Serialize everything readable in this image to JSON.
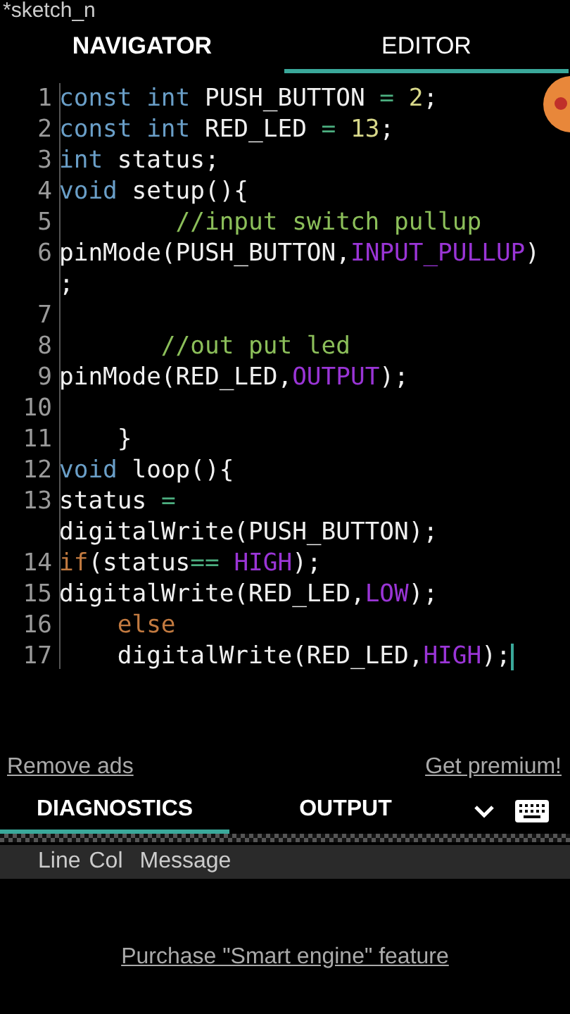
{
  "window": {
    "title": "*sketch_n"
  },
  "tabs": [
    {
      "label": "NAVIGATOR",
      "selected": false
    },
    {
      "label": "EDITOR",
      "selected": true
    }
  ],
  "editor": {
    "lines": [
      {
        "number": "1",
        "tokens": [
          {
            "kind": "keyword",
            "text": "const int "
          },
          {
            "kind": "plain",
            "text": "PUSH_BUTTON "
          },
          {
            "kind": "operator",
            "text": "= "
          },
          {
            "kind": "number",
            "text": "2"
          },
          {
            "kind": "plain",
            "text": ";"
          }
        ]
      },
      {
        "number": "2",
        "tokens": [
          {
            "kind": "keyword",
            "text": "const int "
          },
          {
            "kind": "plain",
            "text": "RED_LED "
          },
          {
            "kind": "operator",
            "text": "= "
          },
          {
            "kind": "number",
            "text": "13"
          },
          {
            "kind": "plain",
            "text": ";"
          }
        ]
      },
      {
        "number": "3",
        "tokens": [
          {
            "kind": "keyword",
            "text": "int "
          },
          {
            "kind": "plain",
            "text": "status;"
          }
        ]
      },
      {
        "number": "4",
        "tokens": [
          {
            "kind": "keyword",
            "text": "void "
          },
          {
            "kind": "plain",
            "text": "setup(){"
          }
        ]
      },
      {
        "number": "5",
        "tokens": [
          {
            "kind": "comment",
            "text": "        //input switch pullup"
          }
        ]
      },
      {
        "number": "6",
        "tokens": [
          {
            "kind": "plain",
            "text": "pinMode(PUSH_BUTTON,"
          },
          {
            "kind": "constant",
            "text": "INPUT_PULLUP"
          },
          {
            "kind": "plain",
            "text": ")"
          },
          {
            "kind": "plain",
            "text": ";"
          }
        ]
      },
      {
        "number": "7"
      },
      {
        "number": "8",
        "tokens": [
          {
            "kind": "comment",
            "text": "       //out put led"
          }
        ]
      },
      {
        "number": "9",
        "tokens": [
          {
            "kind": "plain",
            "text": "pinMode(RED_LED,"
          },
          {
            "kind": "constant",
            "text": "OUTPUT"
          },
          {
            "kind": "plain",
            "text": ");"
          }
        ]
      },
      {
        "number": "10"
      },
      {
        "number": "11",
        "tokens": [
          {
            "kind": "plain",
            "text": "    }"
          }
        ]
      },
      {
        "number": "12",
        "tokens": [
          {
            "kind": "keyword",
            "text": "void "
          },
          {
            "kind": "plain",
            "text": "loop(){"
          }
        ]
      },
      {
        "number": "13",
        "tokens": [
          {
            "kind": "plain",
            "text": "status "
          },
          {
            "kind": "operator",
            "text": "= "
          },
          {
            "kind": "plain",
            "text": "digitalWrite(PUSH_BUTTON);"
          }
        ]
      },
      {
        "number": "14",
        "tokens": [
          {
            "kind": "control",
            "text": "if"
          },
          {
            "kind": "plain",
            "text": "(status"
          },
          {
            "kind": "operator",
            "text": "== "
          },
          {
            "kind": "constant",
            "text": "HIGH"
          },
          {
            "kind": "plain",
            "text": ");"
          }
        ]
      },
      {
        "number": "15",
        "tokens": [
          {
            "kind": "plain",
            "text": "digitalWrite(RED_LED,"
          },
          {
            "kind": "constant",
            "text": "LOW"
          },
          {
            "kind": "plain",
            "text": ");"
          }
        ]
      },
      {
        "number": "16",
        "tokens": [
          {
            "kind": "control",
            "text": "    else"
          }
        ]
      },
      {
        "number": "17",
        "tokens": [
          {
            "kind": "plain",
            "text": "    digitalWrite(RED_LED,"
          },
          {
            "kind": "constant",
            "text": "HIGH"
          },
          {
            "kind": "plain",
            "text": ");"
          }
        ]
      }
    ]
  },
  "links": [
    "Remove ads",
    "Get premium!"
  ],
  "bottom_tabs": [
    {
      "label": "DIAGNOSTICS",
      "selected": true
    },
    {
      "label": "OUTPUT",
      "selected": false
    }
  ],
  "diagnostics": {
    "columns": [
      "Line",
      "Col",
      "Message"
    ]
  },
  "purchase_link": "Purchase \"Smart engine\" feature"
}
